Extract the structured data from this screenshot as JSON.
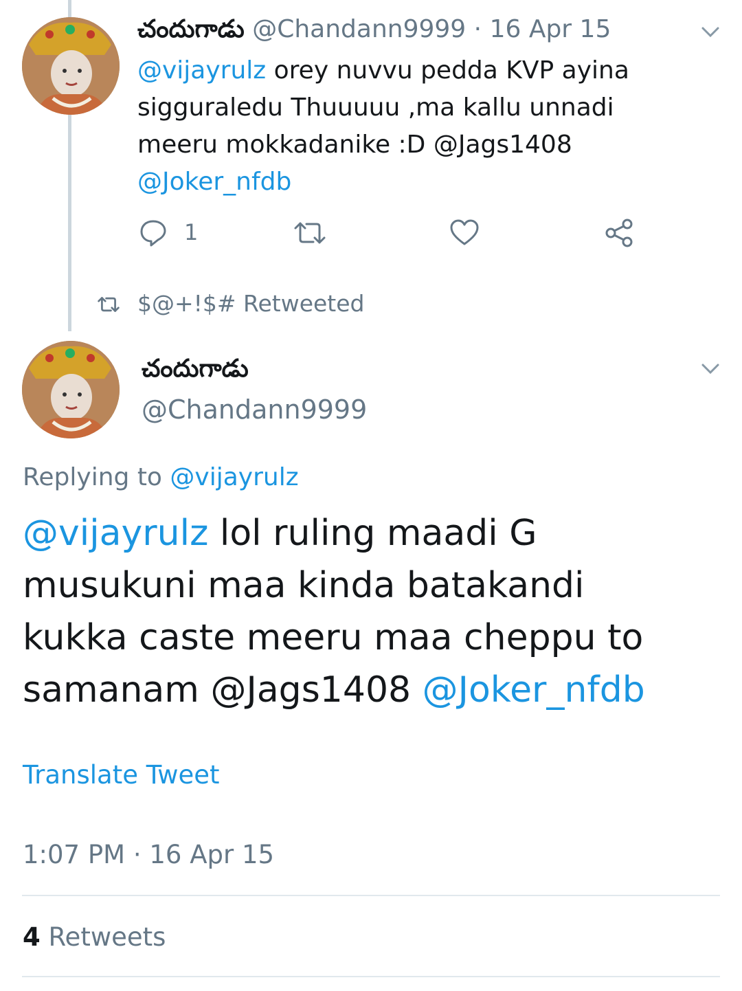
{
  "prev_tweet": {
    "display_name": "చందుగాడు",
    "handle": "@Chandann9999",
    "separator": "·",
    "date": "16 Apr 15",
    "text_mention": "@vijayrulz",
    "text_line1_rest": " orey nuvvu pedda KVP ayina",
    "text_line2": "sigguraledu Thuuuuu ,ma kallu unnadi",
    "text_line3": "meeru mokkadanike :D @Jags1408",
    "text_line4_mention": "@Joker_nfdb",
    "reply_count": "1"
  },
  "retweet_context": {
    "label": "$@+!$# Retweeted"
  },
  "main_tweet": {
    "display_name": "చందుగాడు",
    "handle": "@Chandann9999",
    "replying_prefix": "Replying to ",
    "replying_to": "@vijayrulz",
    "body_mention1": "@vijayrulz",
    "body_line1_rest": " lol ruling maadi G",
    "body_line2": "musukuni maa kinda batakandi",
    "body_line3": "kukka caste meeru maa cheppu to",
    "body_line4_start": "samanam @Jags1408 ",
    "body_line4_mention": "@Joker_nfdb",
    "translate_label": "Translate Tweet",
    "time": "1:07 PM",
    "separator": "·",
    "date": "16 Apr 15",
    "retweet_count": "4",
    "retweet_label": " Retweets"
  },
  "icons": {
    "reply": "reply-icon",
    "retweet": "retweet-icon",
    "like": "heart-icon",
    "share": "share-icon",
    "more": "chevron-down-icon"
  },
  "colors": {
    "link": "#1b95e0",
    "secondary": "#657786",
    "divider": "#e1e8ed"
  }
}
